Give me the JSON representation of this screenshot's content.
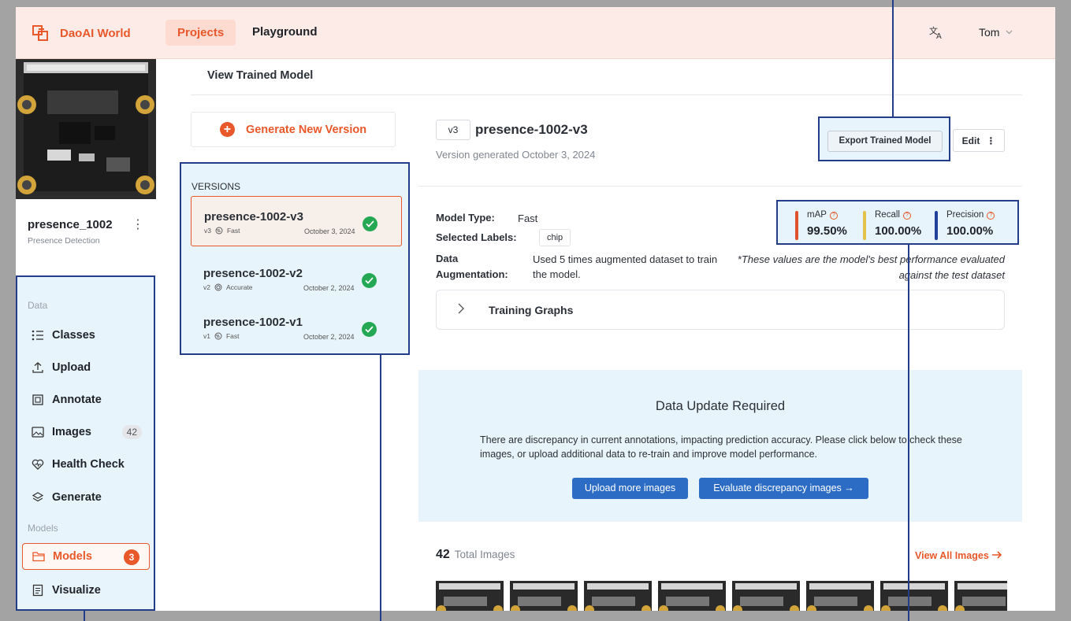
{
  "brand": {
    "name": "DaoAI World"
  },
  "nav": {
    "projects": "Projects",
    "playground": "Playground"
  },
  "user": {
    "name": "Tom"
  },
  "project": {
    "name": "presence_1002",
    "subtitle": "Presence Detection"
  },
  "sidebar": {
    "section_data": "Data",
    "section_models": "Models",
    "items": [
      {
        "label": "Classes",
        "icon": "list-icon"
      },
      {
        "label": "Upload",
        "icon": "upload-icon"
      },
      {
        "label": "Annotate",
        "icon": "annotate-icon"
      },
      {
        "label": "Images",
        "icon": "image-icon",
        "count": "42"
      },
      {
        "label": "Health Check",
        "icon": "heart-icon"
      },
      {
        "label": "Generate",
        "icon": "layers-icon"
      },
      {
        "label": "Models",
        "icon": "folder-icon",
        "count": "3",
        "active": true
      },
      {
        "label": "Visualize",
        "icon": "document-icon"
      }
    ]
  },
  "page": {
    "title": "View Trained Model"
  },
  "generate_button": "Generate New Version",
  "versions": {
    "label": "VERSIONS",
    "items": [
      {
        "name": "presence-1002-v3",
        "tag": "v3",
        "type": "Fast",
        "date": "October 3, 2024",
        "active": true
      },
      {
        "name": "presence-1002-v2",
        "tag": "v2",
        "type": "Accurate",
        "date": "October 2, 2024"
      },
      {
        "name": "presence-1002-v1",
        "tag": "v1",
        "type": "Fast",
        "date": "October 2, 2024"
      }
    ]
  },
  "model": {
    "tag": "v3",
    "name": "presence-1002-v3",
    "generated": "Version generated October 3, 2024",
    "export_label": "Export Trained Model",
    "edit_label": "Edit",
    "type_label": "Model Type:",
    "type_value": "Fast",
    "labels_label": "Selected Labels:",
    "labels": [
      "chip"
    ],
    "aug_label_1": "Data",
    "aug_label_2": "Augmentation:",
    "aug_value": "Used 5 times augmented dataset to train the model.",
    "metrics": [
      {
        "label": "mAP",
        "value": "99.50%",
        "color": "#e0522d"
      },
      {
        "label": "Recall",
        "value": "100.00%",
        "color": "#e3c24a"
      },
      {
        "label": "Precision",
        "value": "100.00%",
        "color": "#21409a"
      }
    ],
    "metrics_note": "*These values are the model's best performance evaluated against the test dataset",
    "graphs_label": "Training Graphs"
  },
  "alert": {
    "title": "Data Update Required",
    "text": "There are discrepancy in current annotations, impacting prediction accuracy. Please click below to check these images, or upload additional data to re-train and improve model performance.",
    "upload_label": "Upload more images",
    "evaluate_label": "Evaluate discrepancy images →"
  },
  "images": {
    "count": "42",
    "label": "Total Images",
    "view_all": "View All Images"
  }
}
